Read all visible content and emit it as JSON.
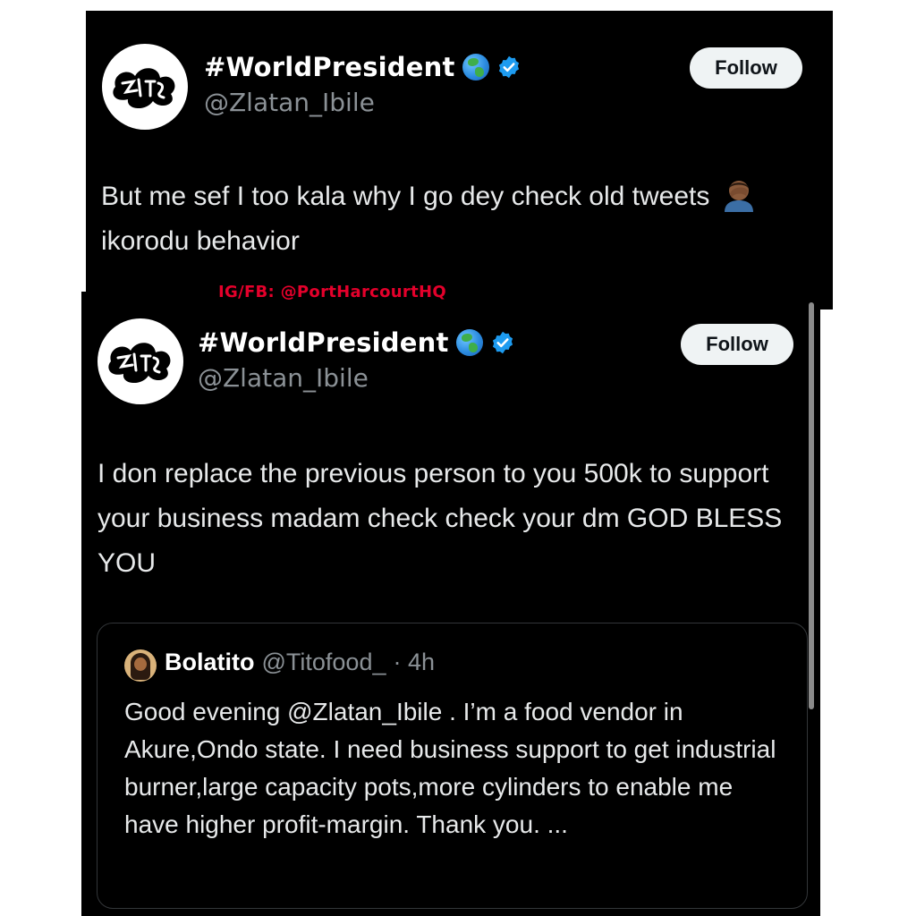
{
  "tweet1": {
    "display_name": "#WorldPresident",
    "handle": "@Zlatan_Ibile",
    "follow_label": "Follow",
    "text_part1": "But me sef I too kala why I go dey check old tweets",
    "text_part2": " ikorodu behavior"
  },
  "watermark": "IG/FB: @PortHarcourtHQ",
  "tweet2": {
    "display_name": "#WorldPresident",
    "handle": "@Zlatan_Ibile",
    "follow_label": "Follow",
    "text": "I don replace the previous person to you 500k to support your business madam check check your dm GOD BLESS YOU",
    "quote": {
      "name": "Bolatito",
      "handle": "@Titofood_",
      "time": "· 4h",
      "text": "Good evening @Zlatan_Ibile . I’m a food vendor in Akure,Ondo state. I need business support to get industrial burner,large capacity pots,more cylinders to enable me have higher profit-margin. Thank you. ..."
    }
  },
  "icons": [
    "zlatan-logo-avatar",
    "globe-icon",
    "verified-icon",
    "facepalm-icon",
    "quote-avatar"
  ],
  "colors": {
    "background": "#000000",
    "verified": "#1d9bf0",
    "watermark": "#e4002b",
    "follow_button": "#eff3f4",
    "handle_gray": "#8b9196"
  }
}
